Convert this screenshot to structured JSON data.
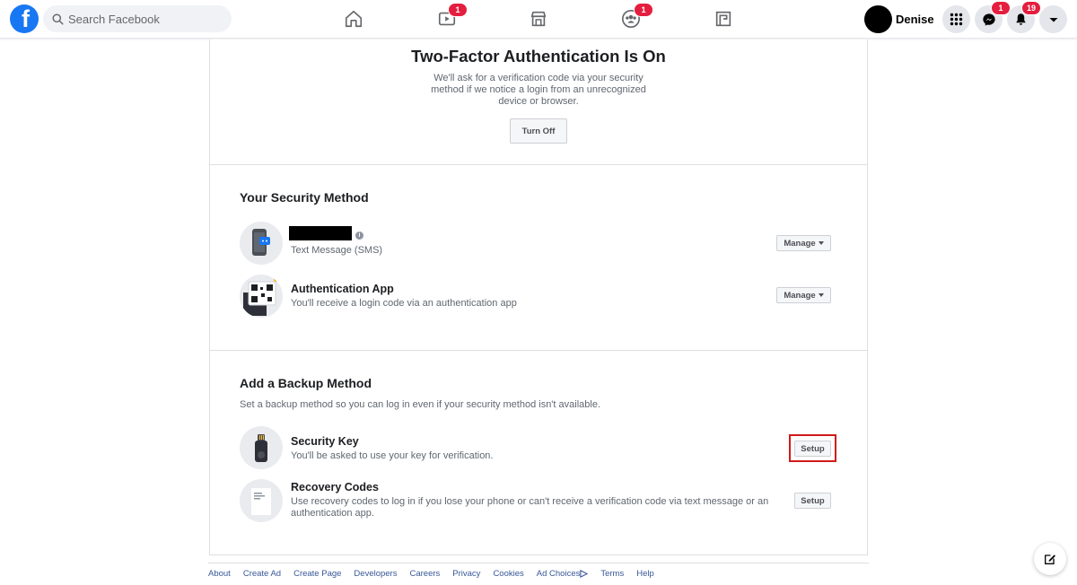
{
  "topbar": {
    "search_placeholder": "Search Facebook",
    "watch_badge": "1",
    "groups_badge": "1",
    "user_name": "Denise",
    "messenger_badge": "1",
    "notifications_badge": "19"
  },
  "hero": {
    "title": "Two-Factor Authentication Is On",
    "text": "We'll ask for a verification code via your security method if we notice a login from an unrecognized device or browser.",
    "turn_off_label": "Turn Off"
  },
  "security_method": {
    "title": "Your Security Method",
    "methods": [
      {
        "title": "",
        "subtitle": "Text Message (SMS)",
        "button": "Manage"
      },
      {
        "title": "Authentication App",
        "subtitle": "You'll receive a login code via an authentication app",
        "button": "Manage"
      }
    ]
  },
  "backup": {
    "title": "Add a Backup Method",
    "description": "Set a backup method so you can log in even if your security method isn't available.",
    "methods": [
      {
        "title": "Security Key",
        "subtitle": "You'll be asked to use your key for verification.",
        "button": "Setup"
      },
      {
        "title": "Recovery Codes",
        "subtitle": "Use recovery codes to log in if you lose your phone or can't receive a verification code via text message or an authentication app.",
        "button": "Setup"
      }
    ]
  },
  "footer": {
    "links": [
      "About",
      "Create Ad",
      "Create Page",
      "Developers",
      "Careers",
      "Privacy",
      "Cookies",
      "Ad Choices",
      "Terms",
      "Help"
    ]
  },
  "colors": {
    "brand": "#1877f2",
    "badge": "#e41e3f",
    "highlight": "#d11a1a",
    "link": "#385898"
  }
}
